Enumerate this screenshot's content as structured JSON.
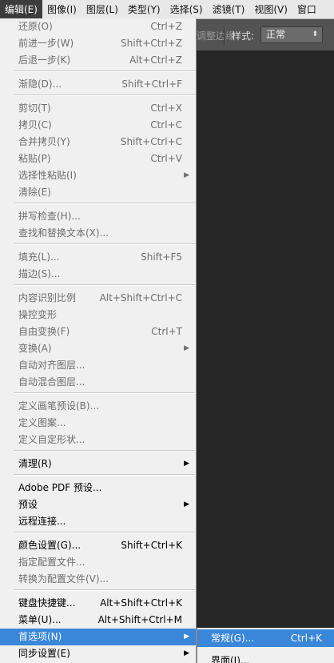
{
  "menubar": {
    "items": [
      "编辑(E)",
      "图像(I)",
      "图层(L)",
      "类型(Y)",
      "选择(S)",
      "滤镜(T)",
      "视图(V)",
      "窗口"
    ]
  },
  "options_bar": {
    "truncated_label": "调整边缘",
    "style_label": "样式:",
    "style_value": "正常"
  },
  "edit_menu": {
    "items": [
      {
        "label": "还原(O)",
        "shortcut": "Ctrl+Z",
        "enabled": false
      },
      {
        "label": "前进一步(W)",
        "shortcut": "Shift+Ctrl+Z",
        "enabled": false
      },
      {
        "label": "后退一步(K)",
        "shortcut": "Alt+Ctrl+Z",
        "enabled": false
      },
      {
        "label": "渐隐(D)...",
        "shortcut": "Shift+Ctrl+F",
        "enabled": false
      },
      {
        "label": "剪切(T)",
        "shortcut": "Ctrl+X",
        "enabled": false
      },
      {
        "label": "拷贝(C)",
        "shortcut": "Ctrl+C",
        "enabled": false
      },
      {
        "label": "合并拷贝(Y)",
        "shortcut": "Shift+Ctrl+C",
        "enabled": false
      },
      {
        "label": "粘贴(P)",
        "shortcut": "Ctrl+V",
        "enabled": false
      },
      {
        "label": "选择性粘贴(I)",
        "shortcut": "",
        "enabled": false,
        "submenu": true
      },
      {
        "label": "清除(E)",
        "shortcut": "",
        "enabled": false
      },
      {
        "label": "拼写检查(H)...",
        "shortcut": "",
        "enabled": false
      },
      {
        "label": "查找和替换文本(X)...",
        "shortcut": "",
        "enabled": false
      },
      {
        "label": "填充(L)...",
        "shortcut": "Shift+F5",
        "enabled": false
      },
      {
        "label": "描边(S)...",
        "shortcut": "",
        "enabled": false
      },
      {
        "label": "内容识别比例",
        "shortcut": "Alt+Shift+Ctrl+C",
        "enabled": false
      },
      {
        "label": "操控变形",
        "shortcut": "",
        "enabled": false
      },
      {
        "label": "自由变换(F)",
        "shortcut": "Ctrl+T",
        "enabled": false
      },
      {
        "label": "变换(A)",
        "shortcut": "",
        "enabled": false,
        "submenu": true
      },
      {
        "label": "自动对齐图层...",
        "shortcut": "",
        "enabled": false
      },
      {
        "label": "自动混合图层...",
        "shortcut": "",
        "enabled": false
      },
      {
        "label": "定义画笔预设(B)...",
        "shortcut": "",
        "enabled": false
      },
      {
        "label": "定义图案...",
        "shortcut": "",
        "enabled": false
      },
      {
        "label": "定义自定形状...",
        "shortcut": "",
        "enabled": false
      },
      {
        "label": "清理(R)",
        "shortcut": "",
        "enabled": true,
        "submenu": true
      },
      {
        "label": "Adobe PDF 预设...",
        "shortcut": "",
        "enabled": true
      },
      {
        "label": "预设",
        "shortcut": "",
        "enabled": true,
        "submenu": true
      },
      {
        "label": "远程连接...",
        "shortcut": "",
        "enabled": true
      },
      {
        "label": "颜色设置(G)...",
        "shortcut": "Shift+Ctrl+K",
        "enabled": true
      },
      {
        "label": "指定配置文件...",
        "shortcut": "",
        "enabled": false
      },
      {
        "label": "转换为配置文件(V)...",
        "shortcut": "",
        "enabled": false
      },
      {
        "label": "键盘快捷键...",
        "shortcut": "Alt+Shift+Ctrl+K",
        "enabled": true
      },
      {
        "label": "菜单(U)...",
        "shortcut": "Alt+Shift+Ctrl+M",
        "enabled": true
      },
      {
        "label": "首选项(N)",
        "shortcut": "",
        "enabled": true,
        "submenu": true,
        "highlighted": true
      },
      {
        "label": "同步设置(E)",
        "shortcut": "",
        "enabled": true,
        "submenu": true
      }
    ]
  },
  "preferences_submenu": {
    "items": [
      {
        "label": "常规(G)...",
        "shortcut": "Ctrl+K",
        "highlighted": true
      },
      {
        "label": "界面(I)...",
        "shortcut": ""
      }
    ]
  },
  "icons": {
    "submenu_arrow": "triangle-right-icon",
    "select_arrow": "up-down-arrow-icon"
  },
  "colors": {
    "highlight": "#3a86d8",
    "menu_bg": "#f0f0f0",
    "disabled_text": "#6d6d6d",
    "workspace_bg": "#262626",
    "options_bar_bg": "#535353"
  }
}
